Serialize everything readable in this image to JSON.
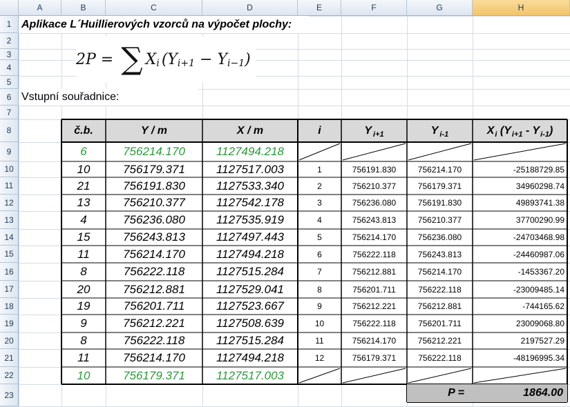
{
  "sheet": {
    "columns": [
      "A",
      "B",
      "C",
      "D",
      "E",
      "F",
      "G",
      "H"
    ],
    "rows": [
      "1",
      "2",
      "3",
      "4",
      "5",
      "6",
      "7",
      "8",
      "9",
      "10",
      "11",
      "12",
      "13",
      "14",
      "15",
      "16",
      "17",
      "18",
      "19",
      "20",
      "21",
      "22",
      "23"
    ],
    "title": "Aplikace L´Huillierových vzorců na výpočet plochy:",
    "formula": {
      "lhs": "2P = ",
      "sum": "∑",
      "x": "X",
      "xi": "i",
      "open": "(Y",
      "sub1": "i+1",
      "minus": " − Y",
      "sub2": "i−1",
      "close": ")"
    },
    "inputs_label": "Vstupní souřadnice:",
    "headers": {
      "cb": "č.b.",
      "y": "Y / m",
      "x": "X / m",
      "i": "i",
      "yip1_main": "Y",
      "yip1_sub": "i+1",
      "yim1_main": "Y",
      "yim1_sub": "i-1",
      "xy_x": "X",
      "xy_i": "i",
      "xy_open": " (Y",
      "xy_sub1": "i+1",
      "xy_minus": " - Y",
      "xy_sub2": "i-1",
      "xy_close": ")"
    },
    "table": [
      {
        "cb": "6",
        "y": "756214.170",
        "x": "1127494.218",
        "i": "",
        "yp": "",
        "ym": "",
        "res": "",
        "green": true,
        "slash": true
      },
      {
        "cb": "10",
        "y": "756179.371",
        "x": "1127517.003",
        "i": "1",
        "yp": "756191.830",
        "ym": "756214.170",
        "res": "-25188729.85"
      },
      {
        "cb": "21",
        "y": "756191.830",
        "x": "1127533.340",
        "i": "2",
        "yp": "756210.377",
        "ym": "756179.371",
        "res": "34960298.74"
      },
      {
        "cb": "13",
        "y": "756210.377",
        "x": "1127542.178",
        "i": "3",
        "yp": "756236.080",
        "ym": "756191.830",
        "res": "49893741.38"
      },
      {
        "cb": "4",
        "y": "756236.080",
        "x": "1127535.919",
        "i": "4",
        "yp": "756243.813",
        "ym": "756210.377",
        "res": "37700290.99"
      },
      {
        "cb": "15",
        "y": "756243.813",
        "x": "1127497.443",
        "i": "5",
        "yp": "756214.170",
        "ym": "756236.080",
        "res": "-24703468.98"
      },
      {
        "cb": "11",
        "y": "756214.170",
        "x": "1127494.218",
        "i": "6",
        "yp": "756222.118",
        "ym": "756243.813",
        "res": "-24460987.06"
      },
      {
        "cb": "8",
        "y": "756222.118",
        "x": "1127515.284",
        "i": "7",
        "yp": "756212.881",
        "ym": "756214.170",
        "res": "-1453367.20"
      },
      {
        "cb": "20",
        "y": "756212.881",
        "x": "1127529.041",
        "i": "8",
        "yp": "756201.711",
        "ym": "756222.118",
        "res": "-23009485.14"
      },
      {
        "cb": "19",
        "y": "756201.711",
        "x": "1127523.667",
        "i": "9",
        "yp": "756212.221",
        "ym": "756212.881",
        "res": "-744165.62"
      },
      {
        "cb": "9",
        "y": "756212.221",
        "x": "1127508.639",
        "i": "10",
        "yp": "756222.118",
        "ym": "756201.711",
        "res": "23009068.80"
      },
      {
        "cb": "8",
        "y": "756222.118",
        "x": "1127515.284",
        "i": "11",
        "yp": "756214.170",
        "ym": "756212.221",
        "res": "2197527.29"
      },
      {
        "cb": "11",
        "y": "756214.170",
        "x": "1127494.218",
        "i": "12",
        "yp": "756179.371",
        "ym": "756222.118",
        "res": "-48196995.34"
      },
      {
        "cb": "10",
        "y": "756179.371",
        "x": "1127517.003",
        "i": "",
        "yp": "",
        "ym": "",
        "res": "",
        "green": true,
        "slash": true
      }
    ],
    "result_label": "P =",
    "result_value": "1864.00"
  }
}
